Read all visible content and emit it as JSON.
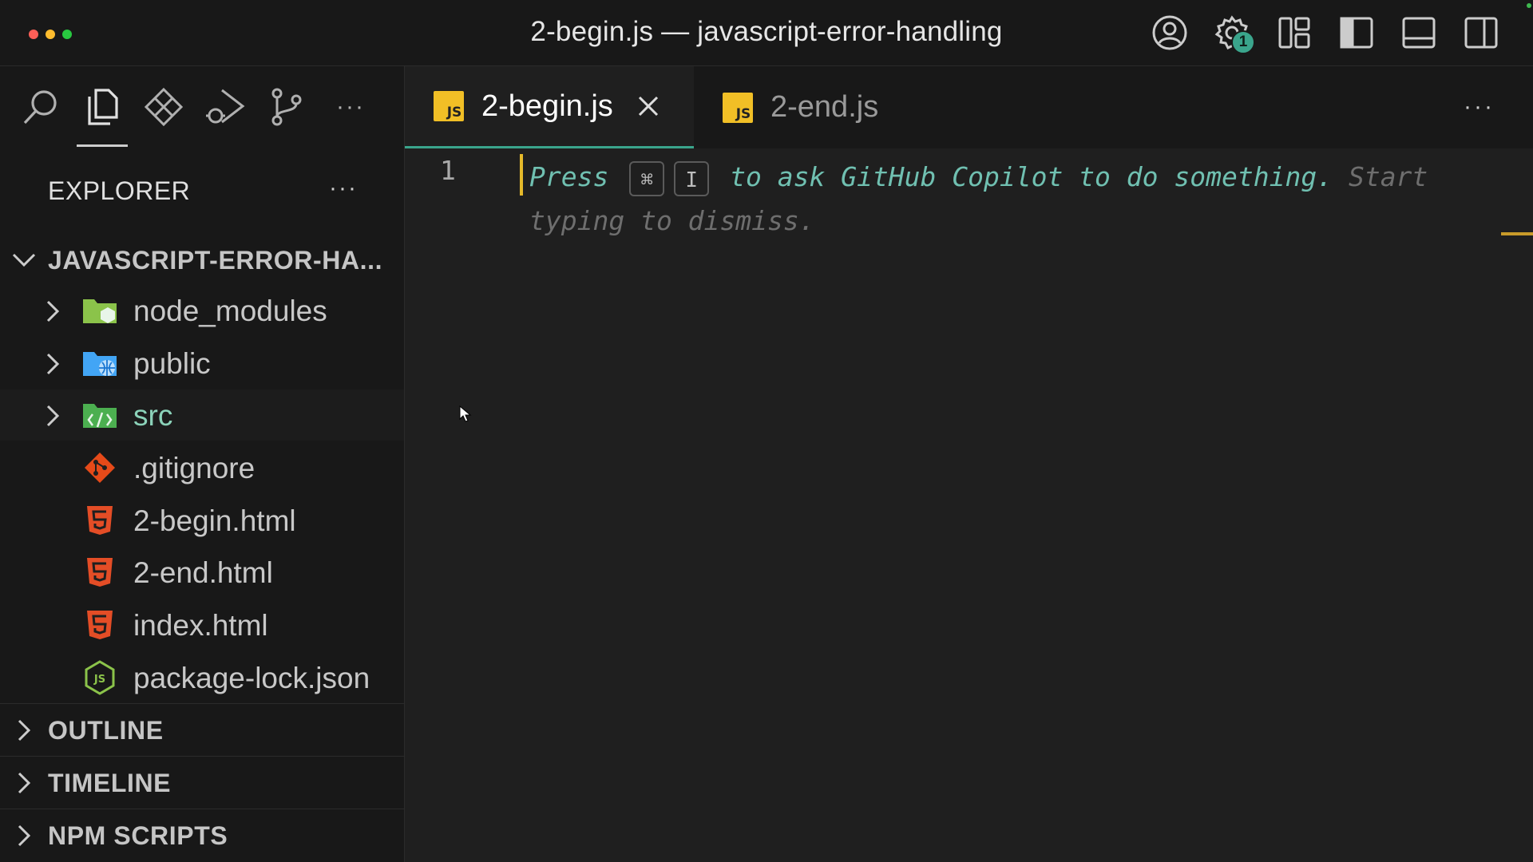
{
  "window": {
    "title": "2-begin.js — javascript-error-handling",
    "traffic_colors": [
      "#ff5f57",
      "#febc2e",
      "#28c840"
    ],
    "notification_badge": "1"
  },
  "activity_bar": {
    "icons": [
      "search-icon",
      "explorer-icon",
      "extensions-icon",
      "run-debug-icon",
      "source-control-icon",
      "more-icon"
    ],
    "active": "explorer-icon",
    "more_label": "···"
  },
  "explorer": {
    "header": "EXPLORER",
    "more_label": "···",
    "project": "JAVASCRIPT-ERROR-HA...",
    "items": [
      {
        "name": "node_modules",
        "type": "folder",
        "icon": "node-folder-icon"
      },
      {
        "name": "public",
        "type": "folder",
        "icon": "public-folder-icon"
      },
      {
        "name": "src",
        "type": "folder",
        "icon": "src-folder-icon"
      },
      {
        "name": ".gitignore",
        "type": "file",
        "icon": "git-icon"
      },
      {
        "name": "2-begin.html",
        "type": "file",
        "icon": "html-icon"
      },
      {
        "name": "2-end.html",
        "type": "file",
        "icon": "html-icon"
      },
      {
        "name": "index.html",
        "type": "file",
        "icon": "html-icon"
      },
      {
        "name": "package-lock.json",
        "type": "file",
        "icon": "nodejs-icon"
      }
    ],
    "sections": [
      "OUTLINE",
      "TIMELINE",
      "NPM SCRIPTS"
    ]
  },
  "tabs": [
    {
      "label": "2-begin.js",
      "active": true,
      "icon": "js-file-icon"
    },
    {
      "label": "2-end.js",
      "active": false,
      "icon": "js-file-icon"
    }
  ],
  "tabs_more_label": "···",
  "editor": {
    "line_number": "1",
    "hint_press": "Press",
    "hint_key1": "⌘",
    "hint_key2": "I",
    "hint_action": "to ask GitHub Copilot to do something.",
    "hint_dismiss": "Start typing to dismiss."
  },
  "colors": {
    "accent": "#3aa58c",
    "js_yellow": "#f1bf26",
    "html_orange": "#e44d26",
    "src_green": "#8bd2b9"
  }
}
